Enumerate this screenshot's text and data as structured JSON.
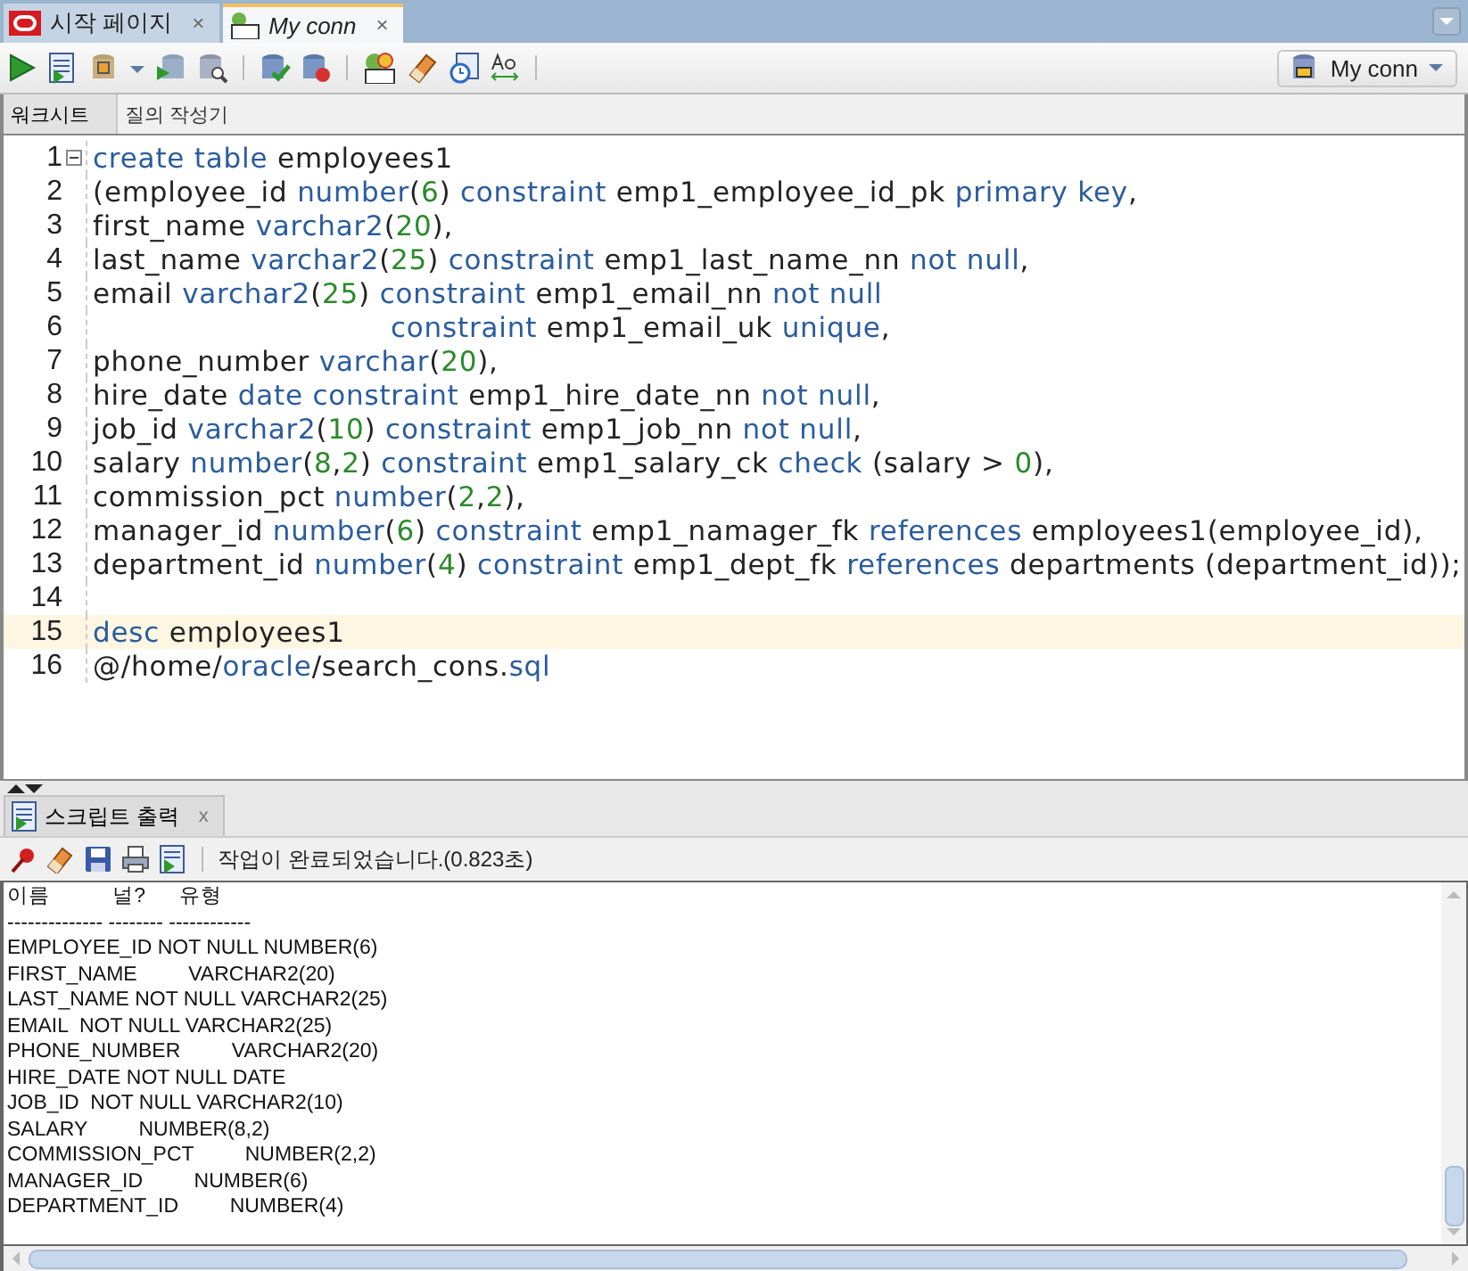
{
  "tabs": [
    {
      "label": "시작 페이지",
      "close": "×",
      "selected": false
    },
    {
      "label": "My conn",
      "close": "×",
      "selected": true
    }
  ],
  "connection": {
    "label": "My conn"
  },
  "sub_tabs": [
    {
      "label": "워크시트",
      "selected": true
    },
    {
      "label": "질의 작성기",
      "selected": false
    }
  ],
  "editor": {
    "lines": [
      {
        "number": "1",
        "current": false,
        "tokens": [
          {
            "kind": "keyword",
            "t": "create table"
          },
          {
            "kind": "plain",
            "t": " employees1"
          }
        ]
      },
      {
        "number": "2",
        "current": false,
        "tokens": [
          {
            "kind": "plain",
            "t": "(employee_id "
          },
          {
            "kind": "keyword",
            "t": "number"
          },
          {
            "kind": "plain",
            "t": "("
          },
          {
            "kind": "number",
            "t": "6"
          },
          {
            "kind": "plain",
            "t": ") "
          },
          {
            "kind": "keyword",
            "t": "constraint"
          },
          {
            "kind": "plain",
            "t": " emp1_employee_id_pk "
          },
          {
            "kind": "keyword",
            "t": "primary key"
          },
          {
            "kind": "plain",
            "t": ","
          }
        ]
      },
      {
        "number": "3",
        "current": false,
        "tokens": [
          {
            "kind": "plain",
            "t": "first_name "
          },
          {
            "kind": "keyword",
            "t": "varchar2"
          },
          {
            "kind": "plain",
            "t": "("
          },
          {
            "kind": "number",
            "t": "20"
          },
          {
            "kind": "plain",
            "t": "),"
          }
        ]
      },
      {
        "number": "4",
        "current": false,
        "tokens": [
          {
            "kind": "plain",
            "t": "last_name "
          },
          {
            "kind": "keyword",
            "t": "varchar2"
          },
          {
            "kind": "plain",
            "t": "("
          },
          {
            "kind": "number",
            "t": "25"
          },
          {
            "kind": "plain",
            "t": ") "
          },
          {
            "kind": "keyword",
            "t": "constraint"
          },
          {
            "kind": "plain",
            "t": " emp1_last_name_nn "
          },
          {
            "kind": "keyword",
            "t": "not null"
          },
          {
            "kind": "plain",
            "t": ","
          }
        ]
      },
      {
        "number": "5",
        "current": false,
        "tokens": [
          {
            "kind": "plain",
            "t": "email "
          },
          {
            "kind": "keyword",
            "t": "varchar2"
          },
          {
            "kind": "plain",
            "t": "("
          },
          {
            "kind": "number",
            "t": "25"
          },
          {
            "kind": "plain",
            "t": ") "
          },
          {
            "kind": "keyword",
            "t": "constraint"
          },
          {
            "kind": "plain",
            "t": " emp1_email_nn "
          },
          {
            "kind": "keyword",
            "t": "not null"
          }
        ]
      },
      {
        "number": "6",
        "current": false,
        "indented": true,
        "tokens": [
          {
            "kind": "keyword",
            "t": "constraint"
          },
          {
            "kind": "plain",
            "t": " emp1_email_uk "
          },
          {
            "kind": "keyword",
            "t": "unique"
          },
          {
            "kind": "plain",
            "t": ","
          }
        ]
      },
      {
        "number": "7",
        "current": false,
        "tokens": [
          {
            "kind": "plain",
            "t": "phone_number "
          },
          {
            "kind": "keyword",
            "t": "varchar"
          },
          {
            "kind": "plain",
            "t": "("
          },
          {
            "kind": "number",
            "t": "20"
          },
          {
            "kind": "plain",
            "t": "),"
          }
        ]
      },
      {
        "number": "8",
        "current": false,
        "tokens": [
          {
            "kind": "plain",
            "t": "hire_date "
          },
          {
            "kind": "keyword",
            "t": "date constraint"
          },
          {
            "kind": "plain",
            "t": " emp1_hire_date_nn "
          },
          {
            "kind": "keyword",
            "t": "not null"
          },
          {
            "kind": "plain",
            "t": ","
          }
        ]
      },
      {
        "number": "9",
        "current": false,
        "tokens": [
          {
            "kind": "plain",
            "t": "job_id "
          },
          {
            "kind": "keyword",
            "t": "varchar2"
          },
          {
            "kind": "plain",
            "t": "("
          },
          {
            "kind": "number",
            "t": "10"
          },
          {
            "kind": "plain",
            "t": ") "
          },
          {
            "kind": "keyword",
            "t": "constraint"
          },
          {
            "kind": "plain",
            "t": " emp1_job_nn "
          },
          {
            "kind": "keyword",
            "t": "not null"
          },
          {
            "kind": "plain",
            "t": ","
          }
        ]
      },
      {
        "number": "10",
        "current": false,
        "tokens": [
          {
            "kind": "plain",
            "t": "salary "
          },
          {
            "kind": "keyword",
            "t": "number"
          },
          {
            "kind": "plain",
            "t": "("
          },
          {
            "kind": "number",
            "t": "8"
          },
          {
            "kind": "plain",
            "t": ","
          },
          {
            "kind": "number",
            "t": "2"
          },
          {
            "kind": "plain",
            "t": ") "
          },
          {
            "kind": "keyword",
            "t": "constraint"
          },
          {
            "kind": "plain",
            "t": " emp1_salary_ck "
          },
          {
            "kind": "keyword",
            "t": "check"
          },
          {
            "kind": "plain",
            "t": " (salary > "
          },
          {
            "kind": "number",
            "t": "0"
          },
          {
            "kind": "plain",
            "t": "),"
          }
        ]
      },
      {
        "number": "11",
        "current": false,
        "tokens": [
          {
            "kind": "plain",
            "t": "commission_pct "
          },
          {
            "kind": "keyword",
            "t": "number"
          },
          {
            "kind": "plain",
            "t": "("
          },
          {
            "kind": "number",
            "t": "2"
          },
          {
            "kind": "plain",
            "t": ","
          },
          {
            "kind": "number",
            "t": "2"
          },
          {
            "kind": "plain",
            "t": "),"
          }
        ]
      },
      {
        "number": "12",
        "current": false,
        "tokens": [
          {
            "kind": "plain",
            "t": "manager_id "
          },
          {
            "kind": "keyword",
            "t": "number"
          },
          {
            "kind": "plain",
            "t": "("
          },
          {
            "kind": "number",
            "t": "6"
          },
          {
            "kind": "plain",
            "t": ") "
          },
          {
            "kind": "keyword",
            "t": "constraint"
          },
          {
            "kind": "plain",
            "t": " emp1_namager_fk "
          },
          {
            "kind": "keyword",
            "t": "references"
          },
          {
            "kind": "plain",
            "t": " employees1(employee_id),"
          }
        ]
      },
      {
        "number": "13",
        "current": false,
        "tokens": [
          {
            "kind": "plain",
            "t": "department_id "
          },
          {
            "kind": "keyword",
            "t": "number"
          },
          {
            "kind": "plain",
            "t": "("
          },
          {
            "kind": "number",
            "t": "4"
          },
          {
            "kind": "plain",
            "t": ") "
          },
          {
            "kind": "keyword",
            "t": "constraint"
          },
          {
            "kind": "plain",
            "t": " emp1_dept_fk "
          },
          {
            "kind": "keyword",
            "t": "references"
          },
          {
            "kind": "plain",
            "t": " departments (department_id));"
          }
        ]
      },
      {
        "number": "14",
        "current": false
      },
      {
        "number": "15",
        "current": true,
        "tokens": [
          {
            "kind": "keyword",
            "t": "desc"
          },
          {
            "kind": "plain",
            "t": " employees1"
          }
        ]
      },
      {
        "number": "16",
        "current": false,
        "tokens": [
          {
            "kind": "plain",
            "t": "@/home/"
          },
          {
            "kind": "keyword",
            "t": "oracle"
          },
          {
            "kind": "plain",
            "t": "/search_cons."
          },
          {
            "kind": "keyword",
            "t": "sql"
          }
        ]
      }
    ]
  },
  "output": {
    "tab": "스크립트 출력",
    "close": "x",
    "status": "작업이 완료되었습니다.(0.823초)",
    "lines": [
      "이름           널?      유형",
      "-------------- -------- ------------",
      "EMPLOYEE_ID NOT NULL NUMBER(6)",
      "FIRST_NAME         VARCHAR2(20)",
      "LAST_NAME NOT NULL VARCHAR2(25)",
      "EMAIL  NOT NULL VARCHAR2(25)",
      "PHONE_NUMBER         VARCHAR2(20)",
      "HIRE_DATE NOT NULL DATE",
      "JOB_ID  NOT NULL VARCHAR2(10)",
      "SALARY         NUMBER(8,2)",
      "COMMISSION_PCT         NUMBER(2,2)",
      "MANAGER_ID         NUMBER(6)",
      "DEPARTMENT_ID         NUMBER(4)"
    ]
  }
}
